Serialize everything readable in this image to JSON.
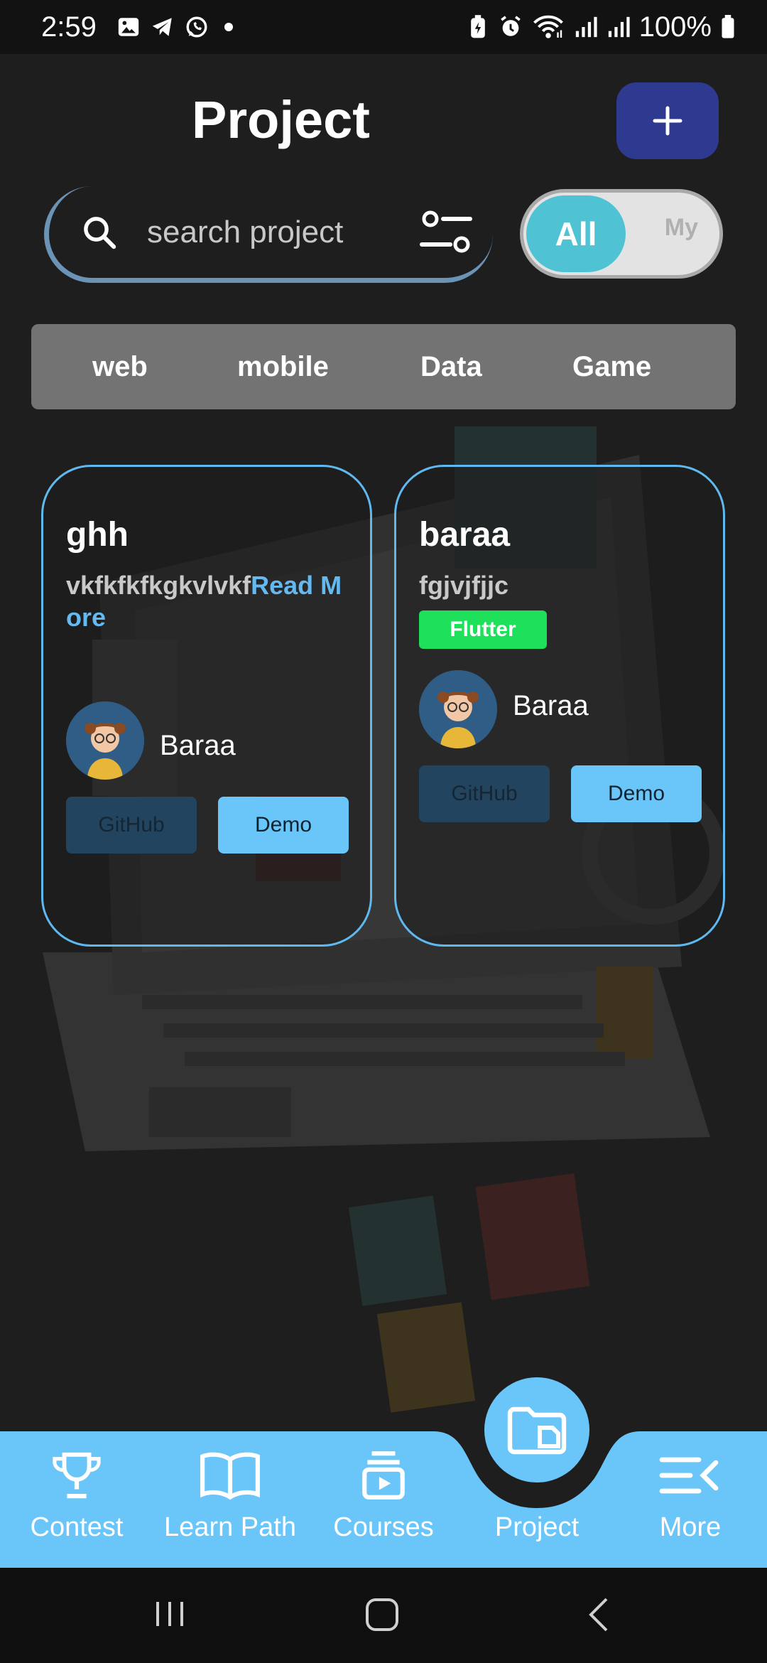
{
  "status_bar": {
    "time": "2:59",
    "battery": "100%",
    "left_icons": [
      "gallery-icon",
      "telegram-icon",
      "whatsapp-icon",
      "dot-icon"
    ],
    "right_icons": [
      "battery-saver-icon",
      "alarm-icon",
      "wifi-icon",
      "signal-icon",
      "signal-icon",
      "battery-icon"
    ]
  },
  "header": {
    "title": "Project",
    "add_button_icon": "plus-icon"
  },
  "search": {
    "placeholder": "search project",
    "value": ""
  },
  "scope_toggle": {
    "selected": "All",
    "options": [
      "All",
      "My"
    ]
  },
  "categories": [
    "web",
    "mobile",
    "Data",
    "Game"
  ],
  "projects": [
    {
      "title": "ghh",
      "description": "vkfkfkfkgkvlvkf",
      "read_more": "Read More",
      "tag": "",
      "author": "Baraa",
      "github_label": "GitHub",
      "demo_label": "Demo"
    },
    {
      "title": "baraa",
      "description": "fgjvjfjjc",
      "read_more": "",
      "tag": "Flutter",
      "author": "Baraa",
      "github_label": "GitHub",
      "demo_label": "Demo"
    }
  ],
  "bottom_nav": {
    "items": [
      {
        "label": "Contest",
        "icon": "trophy-icon"
      },
      {
        "label": "Learn Path",
        "icon": "book-icon"
      },
      {
        "label": "Courses",
        "icon": "courses-icon"
      },
      {
        "label": "Project",
        "icon": "folder-icon",
        "active": true
      },
      {
        "label": "More",
        "icon": "menu-collapse-icon"
      }
    ]
  },
  "colors": {
    "background": "#1e1e1e",
    "accent": "#6ac6f8",
    "card_border": "#5fb8ee",
    "add_button": "#2d3a8f",
    "toggle_active": "#4fc3d4",
    "tag_flutter": "#1ee05a",
    "category_bar": "#737373"
  }
}
